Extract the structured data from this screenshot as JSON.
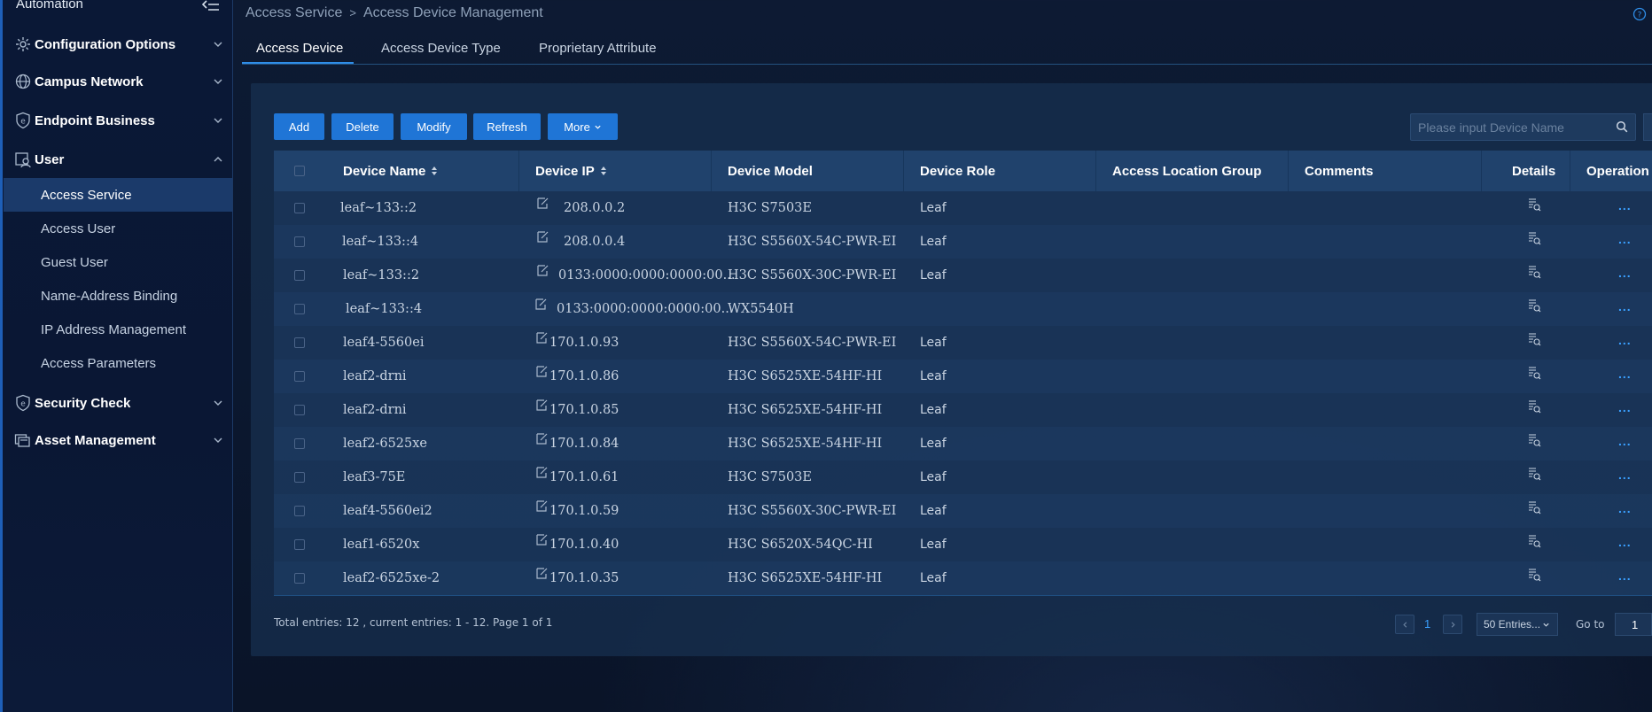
{
  "sidebar": {
    "top_label": "Automation",
    "groups": [
      {
        "label": "Configuration Options",
        "icon": "gear-icon",
        "expanded": false
      },
      {
        "label": "Campus Network",
        "icon": "globe-icon",
        "expanded": false
      },
      {
        "label": "Endpoint Business",
        "icon": "shield-e-icon",
        "expanded": false
      },
      {
        "label": "User",
        "icon": "user-icon",
        "expanded": true
      },
      {
        "label": "Security Check",
        "icon": "shield-check-icon",
        "expanded": false
      },
      {
        "label": "Asset Management",
        "icon": "asset-icon",
        "expanded": false
      }
    ],
    "user_items": [
      {
        "label": "Access Service",
        "active": true
      },
      {
        "label": "Access User",
        "active": false
      },
      {
        "label": "Guest User",
        "active": false
      },
      {
        "label": "Name-Address Binding",
        "active": false
      },
      {
        "label": "IP Address Management",
        "active": false
      },
      {
        "label": "Access Parameters",
        "active": false
      }
    ]
  },
  "breadcrumb": {
    "part1": "Access Service",
    "separator": ">",
    "part2": "Access Device Management"
  },
  "tabs": [
    {
      "label": "Access Device",
      "active": true
    },
    {
      "label": "Access Device Type",
      "active": false
    },
    {
      "label": "Proprietary Attribute",
      "active": false
    }
  ],
  "toolbar": {
    "add": "Add",
    "delete": "Delete",
    "modify": "Modify",
    "refresh": "Refresh",
    "more": "More"
  },
  "search": {
    "placeholder": "Please input Device Name"
  },
  "table": {
    "headers": {
      "name": "Device Name",
      "ip": "Device IP",
      "model": "Device Model",
      "role": "Device Role",
      "location": "Access Location Group",
      "comments": "Comments",
      "details": "Details",
      "operation": "Operation"
    },
    "rows": [
      {
        "name": "leaf~133::2",
        "ip": "208.0.0.2",
        "model": "H3C S7503E",
        "role": "Leaf",
        "op": "..."
      },
      {
        "name": "leaf~133::4",
        "ip": "208.0.0.4",
        "model": "H3C S5560X-54C-PWR-EI",
        "role": "Leaf",
        "op": "..."
      },
      {
        "name": "leaf~133::2",
        "ip": "0133:0000:0000:0000:00...",
        "model": "H3C S5560X-30C-PWR-EI",
        "role": "Leaf",
        "op": "..."
      },
      {
        "name": "leaf~133::4",
        "ip": "0133:0000:0000:0000:00...",
        "model": "WX5540H",
        "role": "",
        "op": "..."
      },
      {
        "name": "leaf4-5560ei",
        "ip": "170.1.0.93",
        "model": "H3C S5560X-54C-PWR-EI",
        "role": "Leaf",
        "op": "..."
      },
      {
        "name": "leaf2-drni",
        "ip": "170.1.0.86",
        "model": "H3C S6525XE-54HF-HI",
        "role": "Leaf",
        "op": "..."
      },
      {
        "name": "leaf2-drni",
        "ip": "170.1.0.85",
        "model": "H3C S6525XE-54HF-HI",
        "role": "Leaf",
        "op": "..."
      },
      {
        "name": "leaf2-6525xe",
        "ip": "170.1.0.84",
        "model": "H3C S6525XE-54HF-HI",
        "role": "Leaf",
        "op": "..."
      },
      {
        "name": "leaf3-75E",
        "ip": "170.1.0.61",
        "model": "H3C S7503E",
        "role": "Leaf",
        "op": "..."
      },
      {
        "name": "leaf4-5560ei2",
        "ip": "170.1.0.59",
        "model": "H3C S5560X-30C-PWR-EI",
        "role": "Leaf",
        "op": "..."
      },
      {
        "name": "leaf1-6520x",
        "ip": "170.1.0.40",
        "model": "H3C S6520X-54QC-HI",
        "role": "Leaf",
        "op": "..."
      },
      {
        "name": "leaf2-6525xe-2",
        "ip": "170.1.0.35",
        "model": "H3C S6525XE-54HF-HI",
        "role": "Leaf",
        "op": "..."
      }
    ]
  },
  "footer": {
    "summary": "Total entries: 12 , current entries: 1 - 12. Page 1 of 1",
    "current_page": "1",
    "page_size": "50 Entries...",
    "goto_label": "Go to",
    "goto_value": "1"
  },
  "colors": {
    "accent": "#1f75d6",
    "link": "#3aa0ff",
    "background": "#0b1830"
  }
}
